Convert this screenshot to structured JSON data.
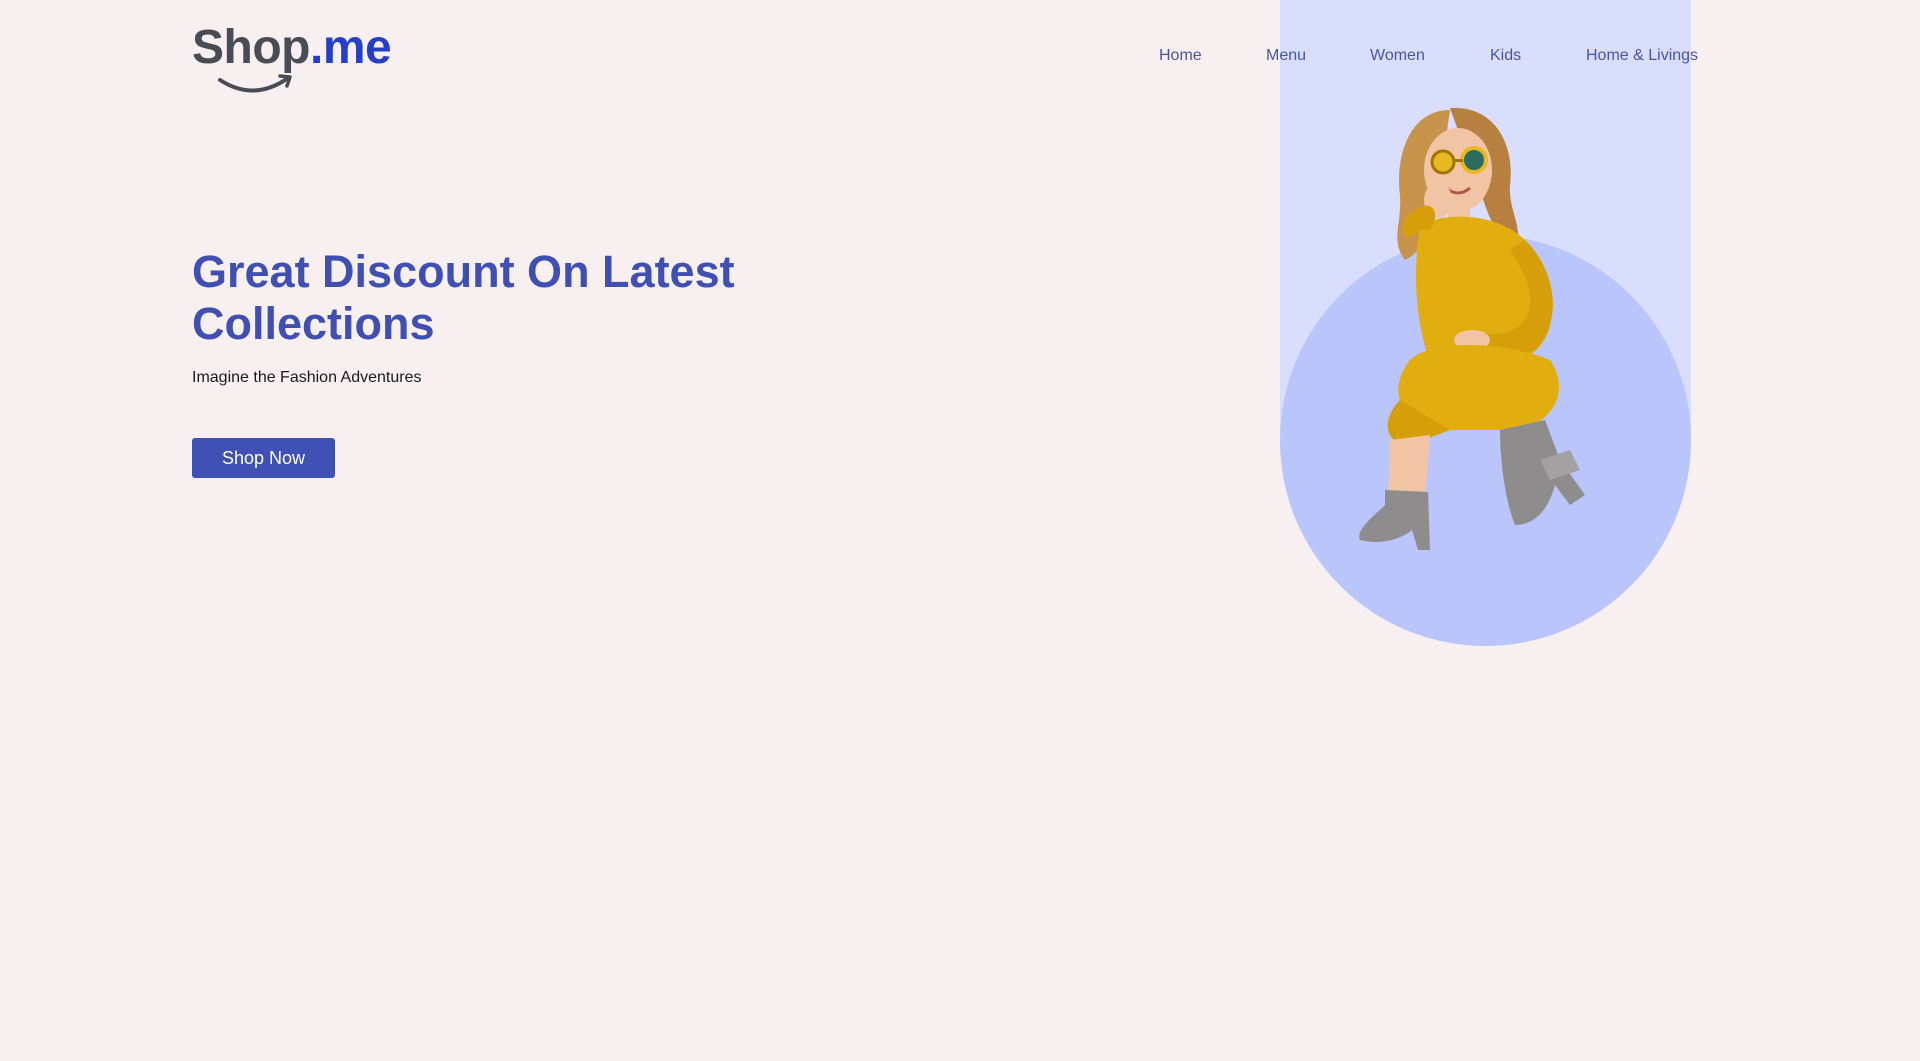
{
  "brand": {
    "name_part": "Shop",
    "tld_part": ".me"
  },
  "nav": {
    "items": [
      {
        "label": "Home"
      },
      {
        "label": "Menu"
      },
      {
        "label": "Women"
      },
      {
        "label": "Kids"
      },
      {
        "label": "Home & Livings"
      }
    ]
  },
  "hero": {
    "title": "Great Discount On Latest Collections",
    "subtitle": "Imagine the Fashion Adventures",
    "cta_label": "Shop Now"
  },
  "colors": {
    "page_background": "#f7eff0",
    "accent": "#3f51b5",
    "nav_text": "#4655a8",
    "logo_grey": "#4a4c55",
    "logo_blue": "#2540c8",
    "hero_band": "#d8defb",
    "hero_circle": "#b9c5fb"
  },
  "icons": {
    "logo_mark": "smile-arrow-icon",
    "hero_image": "woman-yellow-dress-illustration"
  }
}
